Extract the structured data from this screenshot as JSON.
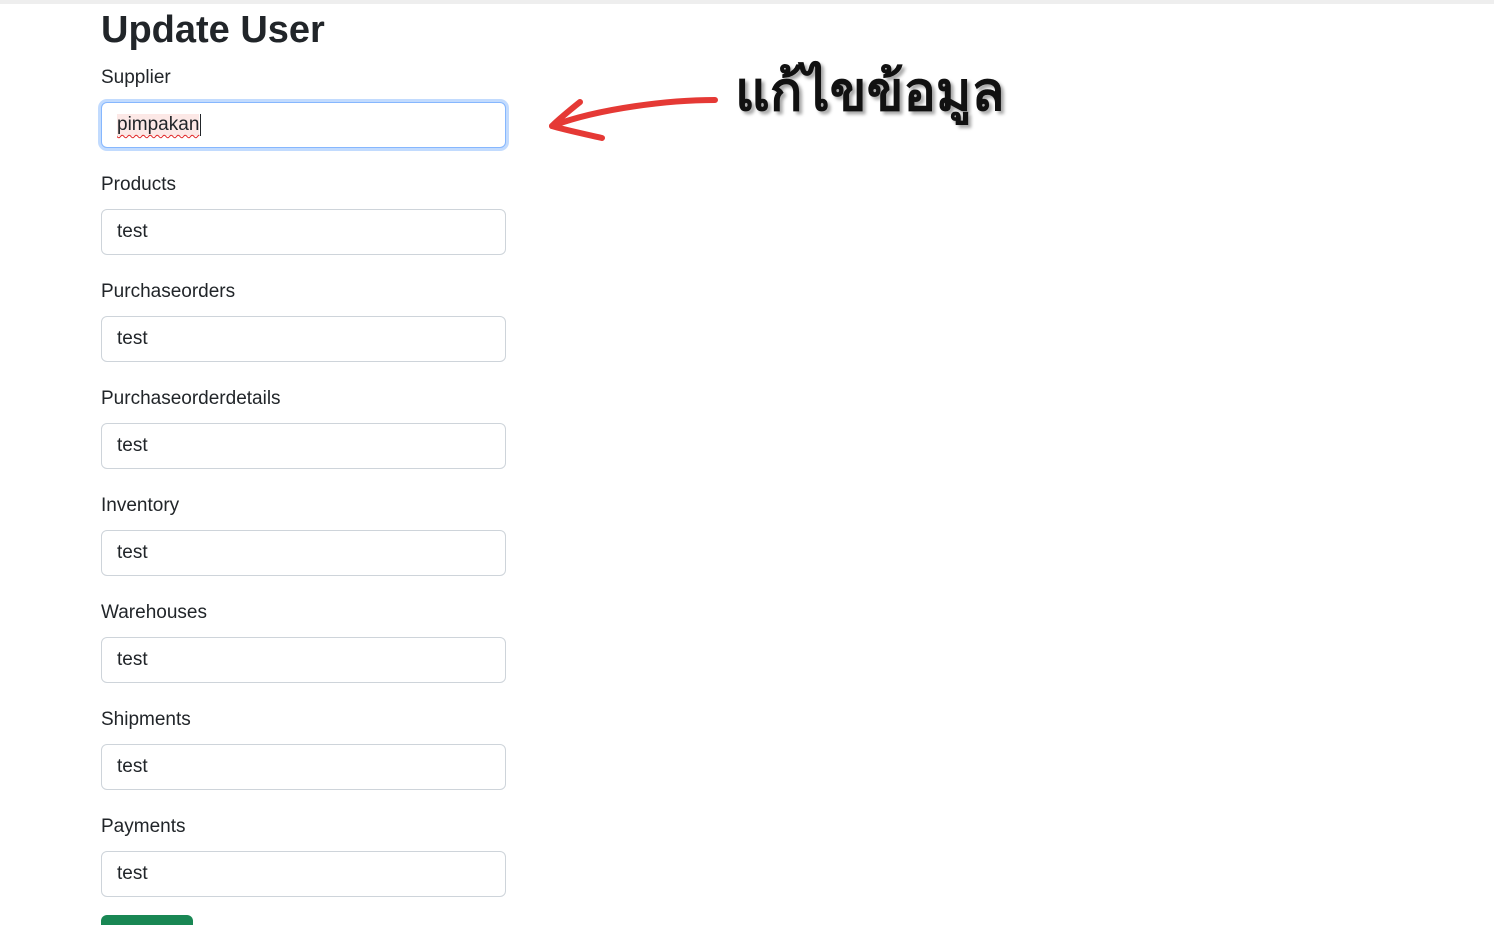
{
  "page": {
    "title": "Update User"
  },
  "form": {
    "fields": [
      {
        "label": "Supplier",
        "value": "pimpakan",
        "focused": true
      },
      {
        "label": "Products",
        "value": "test"
      },
      {
        "label": "Purchaseorders",
        "value": "test"
      },
      {
        "label": "Purchaseorderdetails",
        "value": "test"
      },
      {
        "label": "Inventory",
        "value": "test"
      },
      {
        "label": "Warehouses",
        "value": "test"
      },
      {
        "label": "Shipments",
        "value": "test"
      },
      {
        "label": "Payments",
        "value": "test"
      }
    ]
  },
  "annotation": {
    "text": "แก้ไขข้อมูล",
    "arrow_color": "#e53935"
  },
  "colors": {
    "focus_border": "#86b7fe",
    "input_border": "#ced4da",
    "submit_button": "#198754"
  }
}
